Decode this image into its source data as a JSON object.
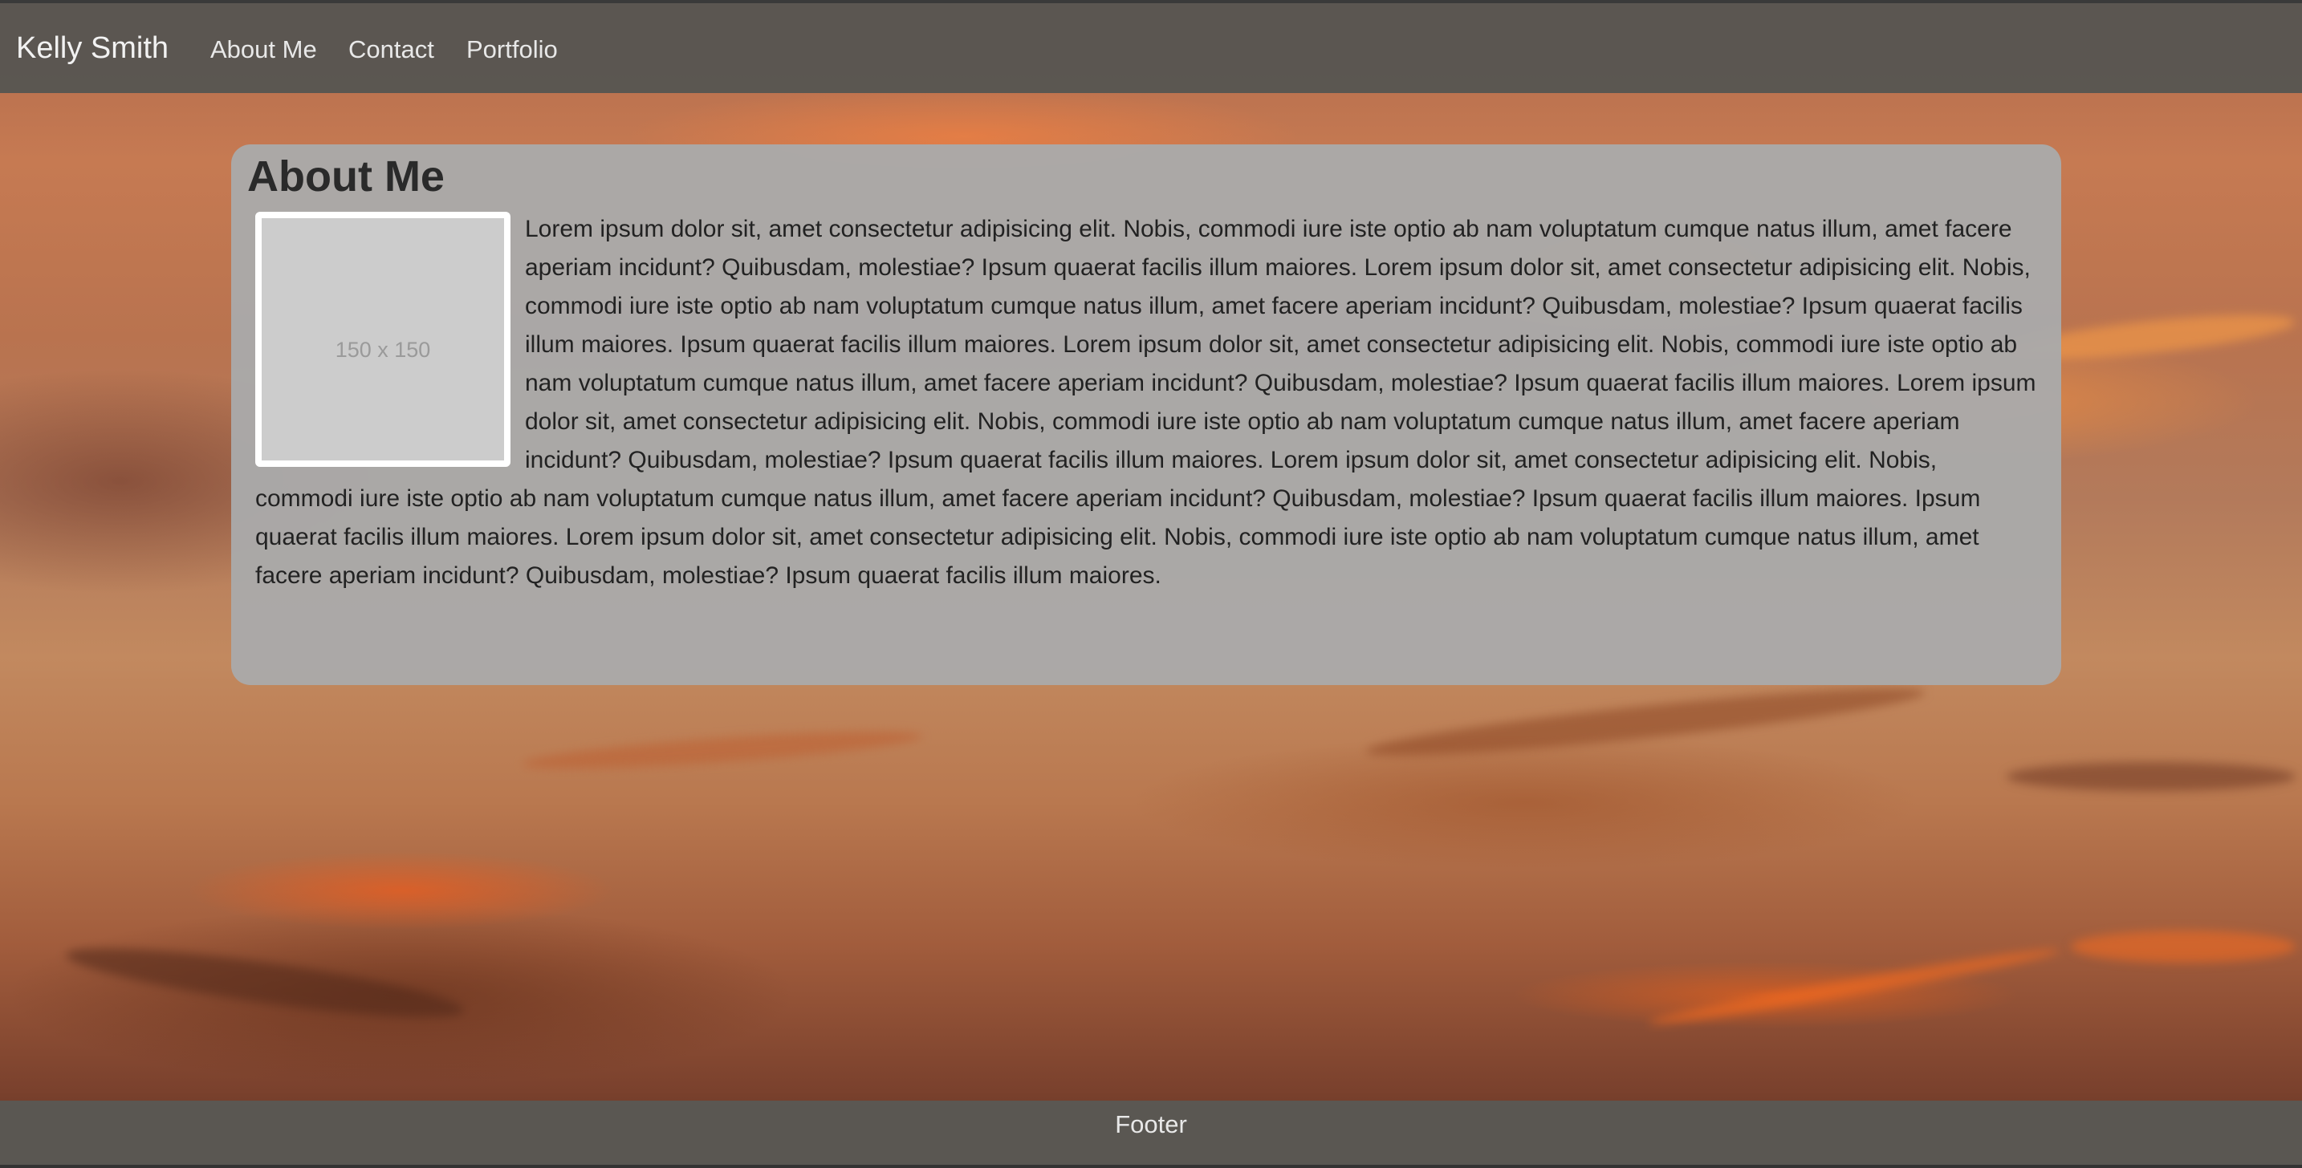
{
  "navbar": {
    "brand": "Kelly Smith",
    "links": [
      "About Me",
      "Contact",
      "Portfolio"
    ]
  },
  "about": {
    "title": "About Me",
    "image_placeholder": "150 x 150",
    "text": "Lorem ipsum dolor sit, amet consectetur adipisicing elit. Nobis, commodi iure iste optio ab nam voluptatum cumque natus illum, amet facere aperiam incidunt? Quibusdam, molestiae? Ipsum quaerat facilis illum maiores. Lorem ipsum dolor sit, amet consectetur adipisicing elit. Nobis, commodi iure iste optio ab nam voluptatum cumque natus illum, amet facere aperiam incidunt? Quibusdam, molestiae? Ipsum quaerat facilis illum maiores. Ipsum quaerat facilis illum maiores. Lorem ipsum dolor sit, amet consectetur adipisicing elit. Nobis, commodi iure iste optio ab nam voluptatum cumque natus illum, amet facere aperiam incidunt? Quibusdam, molestiae? Ipsum quaerat facilis illum maiores. Lorem ipsum dolor sit, amet consectetur adipisicing elit. Nobis, commodi iure iste optio ab nam voluptatum cumque natus illum, amet facere aperiam incidunt? Quibusdam, molestiae? Ipsum quaerat facilis illum maiores. Lorem ipsum dolor sit, amet consectetur adipisicing elit. Nobis, commodi iure iste optio ab nam voluptatum cumque natus illum, amet facere aperiam incidunt? Quibusdam, molestiae? Ipsum quaerat facilis illum maiores. Ipsum quaerat facilis illum maiores. Lorem ipsum dolor sit, amet consectetur adipisicing elit. Nobis, commodi iure iste optio ab nam voluptatum cumque natus illum, amet facere aperiam incidunt? Quibusdam, molestiae? Ipsum quaerat facilis illum maiores."
  },
  "footer": {
    "text": "Footer"
  },
  "colors": {
    "navbar_bg": "#585652",
    "card_bg": "#aaaaaa",
    "nav_text": "#e8e8e8"
  }
}
